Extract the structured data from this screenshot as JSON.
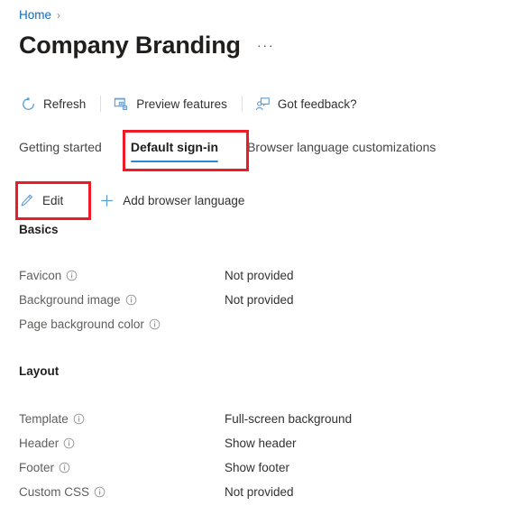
{
  "breadcrumb": {
    "home_label": "Home",
    "separator": "›"
  },
  "header": {
    "title": "Company Branding",
    "more_label": "···"
  },
  "commandbar": {
    "items": [
      {
        "label": "Refresh",
        "icon": "refresh-icon"
      },
      {
        "label": "Preview features",
        "icon": "preview-features-icon"
      },
      {
        "label": "Got feedback?",
        "icon": "feedback-icon"
      }
    ]
  },
  "tabs": [
    {
      "label": "Getting started",
      "active": false
    },
    {
      "label": "Default sign-in",
      "active": true
    },
    {
      "label": "Browser language customizations",
      "active": false
    }
  ],
  "actionbar": {
    "edit_label": "Edit",
    "edit_icon": "pencil-icon",
    "add_label": "Add browser language",
    "add_icon": "plus-icon"
  },
  "sections": [
    {
      "heading": "Basics",
      "rows": [
        {
          "label": "Favicon",
          "info": "info-icon",
          "value": "Not provided"
        },
        {
          "label": "Background image",
          "info": "info-icon",
          "value": "Not provided"
        },
        {
          "label": "Page background color",
          "info": "info-icon",
          "value": ""
        }
      ]
    },
    {
      "heading": "Layout",
      "rows": [
        {
          "label": "Template",
          "info": "info-icon",
          "value": "Full-screen background"
        },
        {
          "label": "Header",
          "info": "info-icon",
          "value": "Show header"
        },
        {
          "label": "Footer",
          "info": "info-icon",
          "value": "Show footer"
        },
        {
          "label": "Custom CSS",
          "info": "info-icon",
          "value": "Not provided"
        }
      ]
    }
  ],
  "annotations": {
    "highlight_color": "#ed1c24",
    "boxes": [
      {
        "target": "Default sign-in tab"
      },
      {
        "target": "Edit button"
      }
    ]
  },
  "colors": {
    "link": "#0f6cbd",
    "accent_underline": "#2b88d8",
    "icon_blue": "#5b9bd5",
    "text_primary": "#201f1e",
    "text_secondary": "#605e5c"
  }
}
